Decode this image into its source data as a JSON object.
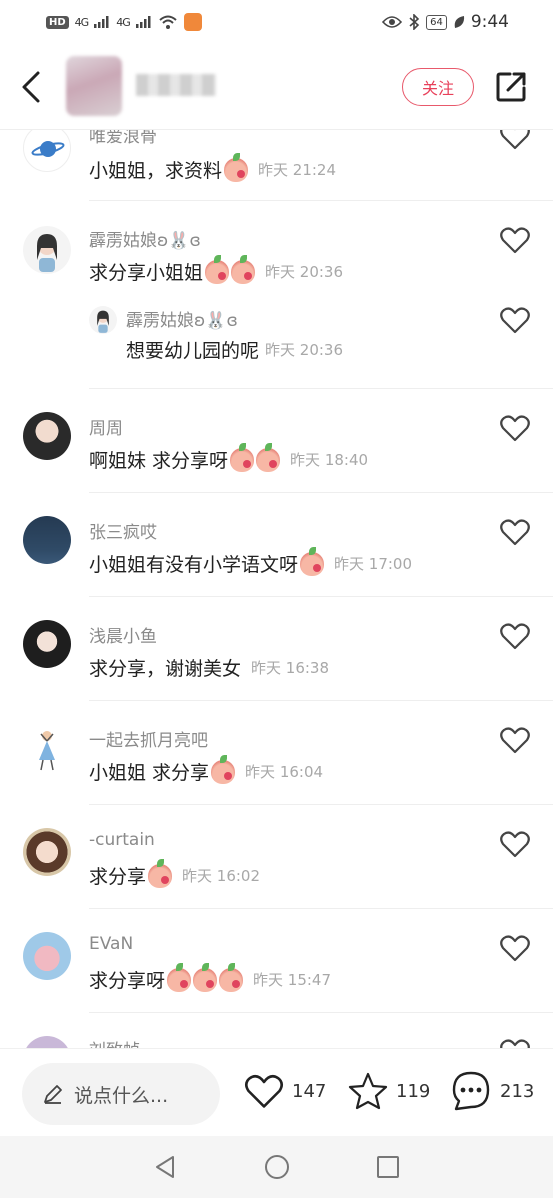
{
  "status_bar": {
    "hd": "HD",
    "net1": "4G",
    "net2": "4G",
    "battery": "64",
    "time": "9:44"
  },
  "header": {
    "follow_label": "关注",
    "back_icon": "chevron-left-icon",
    "share_icon": "share-icon"
  },
  "comments": [
    {
      "name": "唯爱浪骨",
      "text": "小姐姐，求资料",
      "emojis": 1,
      "time": "昨天 21:24"
    },
    {
      "name": "霹雳姑娘ʚ🐰ɞ",
      "text": "求分享小姐姐",
      "emojis": 2,
      "time": "昨天 20:36"
    },
    {
      "name": "霹雳姑娘ʚ🐰ɞ",
      "text": "想要幼儿园的呢",
      "emojis": 0,
      "time": "昨天 20:36"
    },
    {
      "name": "周周",
      "text": "啊姐妹 求分享呀",
      "emojis": 2,
      "time": "昨天 18:40"
    },
    {
      "name": "张三疯哎",
      "text": "小姐姐有没有小学语文呀",
      "emojis": 1,
      "time": "昨天 17:00"
    },
    {
      "name": "浅晨小鱼",
      "text": "求分享，谢谢美女",
      "emojis": 0,
      "time": "昨天 16:38"
    },
    {
      "name": "一起去抓月亮吧",
      "text": "小姐姐 求分享",
      "emojis": 1,
      "time": "昨天 16:04"
    },
    {
      "name": "-curtain",
      "text": "求分享",
      "emojis": 1,
      "time": "昨天 16:02"
    },
    {
      "name": "EVaN",
      "text": "求分享呀",
      "emojis": 3,
      "time": "昨天 15:47"
    },
    {
      "name": "刘致帧",
      "text": "",
      "emojis": 0,
      "time": ""
    }
  ],
  "bottom_bar": {
    "input_placeholder": "说点什么...",
    "likes": "147",
    "favorites": "119",
    "comments": "213"
  },
  "colors": {
    "accent": "#e8405a",
    "muted": "#8a8a8a",
    "time": "#a8a8a8"
  }
}
